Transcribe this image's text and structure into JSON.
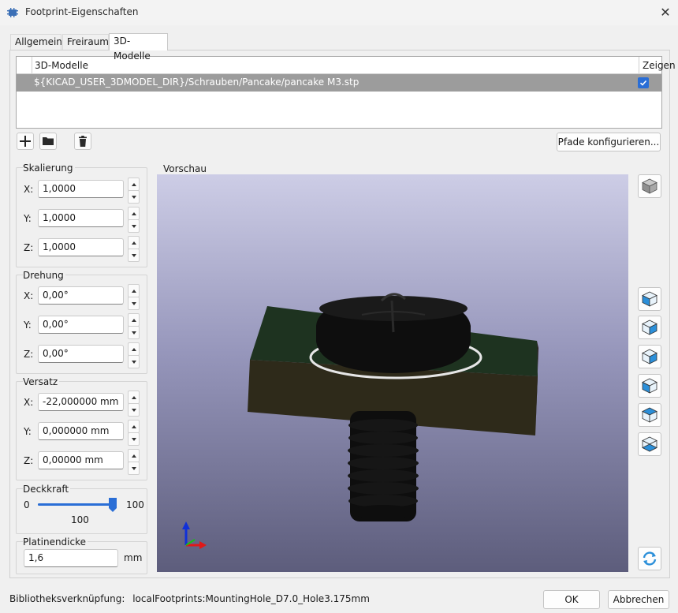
{
  "window": {
    "title": "Footprint-Eigenschaften",
    "close_glyph": "✕"
  },
  "tabs": [
    {
      "label": "Allgemein"
    },
    {
      "label": "Freiraum"
    },
    {
      "label": "3D-Modelle",
      "active": true
    }
  ],
  "models_table": {
    "headers": {
      "model": "3D-Modelle",
      "show": "Zeigen"
    },
    "rows": [
      {
        "path": "${KICAD_USER_3DMODEL_DIR}/Schrauben/Pancake/pancake M3.stp",
        "shown": true
      }
    ]
  },
  "toolbar": {
    "icons": [
      "plus-icon",
      "folder-icon",
      "trash-icon"
    ],
    "configure_paths_label": "Pfade konfigurieren..."
  },
  "scaling": {
    "title": "Skalierung",
    "x_label": "X:",
    "x_value": "1,0000",
    "y_label": "Y:",
    "y_value": "1,0000",
    "z_label": "Z:",
    "z_value": "1,0000"
  },
  "rotation": {
    "title": "Drehung",
    "x_label": "X:",
    "x_value": "0,00°",
    "y_label": "Y:",
    "y_value": "0,00°",
    "z_label": "Z:",
    "z_value": "0,00°"
  },
  "offset": {
    "title": "Versatz",
    "x_label": "X:",
    "x_value": "-22,000000 mm",
    "y_label": "Y:",
    "y_value": "0,000000 mm",
    "z_label": "Z:",
    "z_value": "0,00000 mm"
  },
  "opacity": {
    "title": "Deckkraft",
    "min_label": "0",
    "max_label": "100",
    "value_label": "100",
    "level": 1.0
  },
  "board_thickness": {
    "title": "Platinendicke",
    "value": "1,6",
    "unit": "mm"
  },
  "preview": {
    "title": "Vorschau",
    "side_icons": [
      "cube-3d-icon",
      "view-front-icon",
      "view-back-icon",
      "view-left-icon",
      "view-right-icon",
      "view-top-icon",
      "view-bottom-icon",
      "reload-icon"
    ],
    "colors": {
      "board": "#1e3320",
      "board_edge": "#2e2a1a",
      "screw": "#0e0e0e",
      "background_top": "#cdcde6",
      "background_bottom": "#5d5d7c"
    }
  },
  "footer": {
    "library_link_label": "Bibliotheksverknüpfung:",
    "library_link_value": "localFootprints:MountingHole_D7.0_Hole3.175mm",
    "ok_label": "OK",
    "cancel_label": "Abbrechen"
  },
  "colors": {
    "accent": "#2a6ed6",
    "selected_row": "#9c9c9c"
  }
}
